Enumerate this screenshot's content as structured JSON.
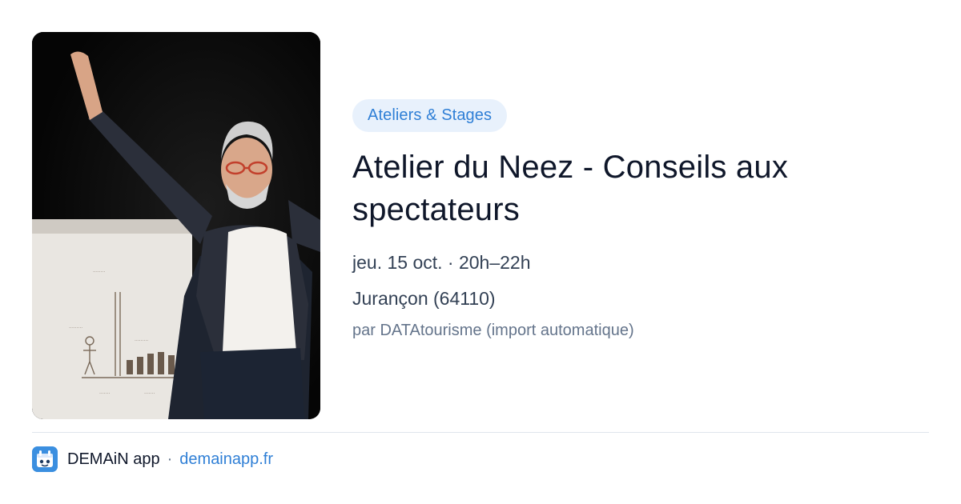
{
  "event": {
    "category": "Ateliers & Stages",
    "title": "Atelier du Neez - Conseils aux spectateurs",
    "datetime": "jeu. 15 oct. · 20h–22h",
    "location": "Jurançon (64110)",
    "source": "par DATAtourisme (import automatique)",
    "image": {
      "icon": "event-photo"
    }
  },
  "footer": {
    "app_name": "DEMAiN app",
    "separator": "·",
    "url": "demainapp.fr",
    "logo_icon": "calendar-icon"
  },
  "colors": {
    "accent": "#2f7fd6",
    "badge_bg": "#e8f1fc",
    "title": "#0f172a",
    "muted": "#64748b"
  }
}
